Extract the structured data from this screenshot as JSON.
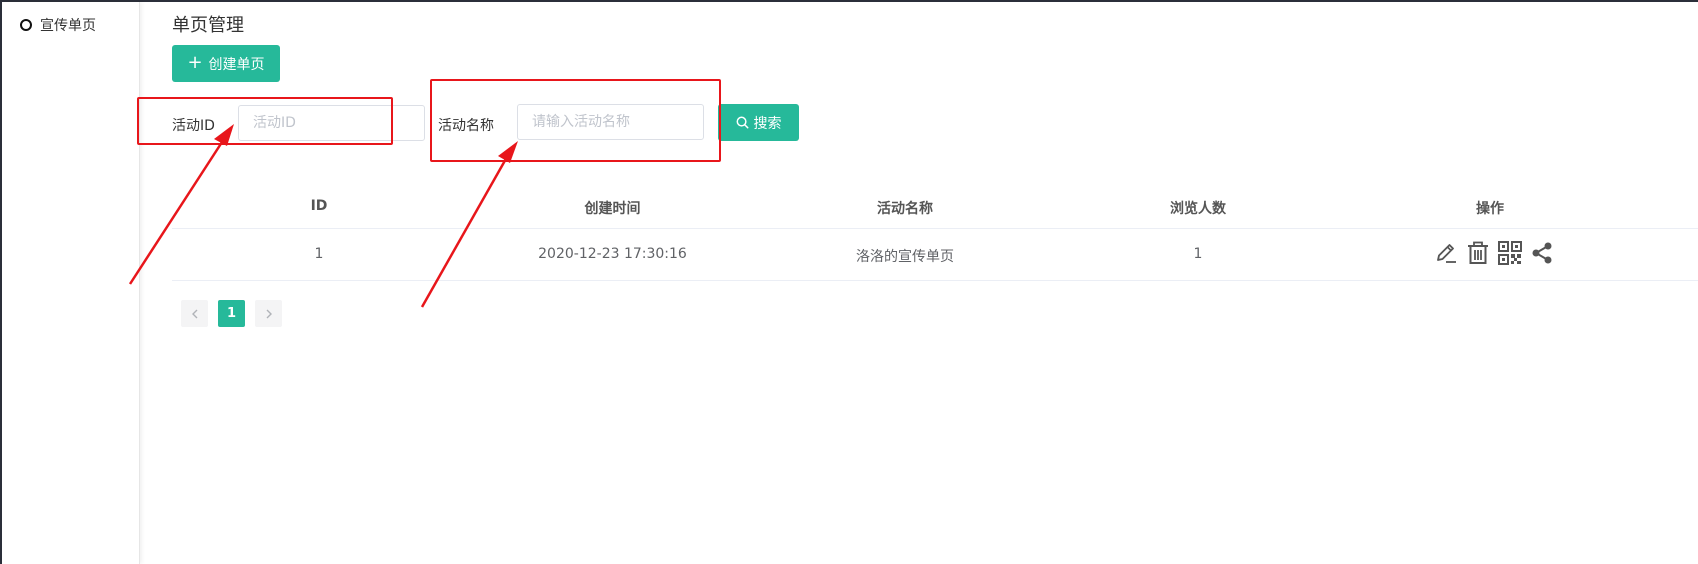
{
  "sidebar": {
    "items": [
      {
        "label": "宣传单页"
      }
    ]
  },
  "main": {
    "title": "单页管理",
    "create_button": "创建单页",
    "filters": {
      "activity_id": {
        "label": "活动ID",
        "placeholder": "活动ID",
        "value": ""
      },
      "activity_name": {
        "label": "活动名称",
        "placeholder": "请输入活动名称",
        "value": ""
      },
      "search_button": "搜索"
    },
    "table": {
      "columns": [
        "ID",
        "创建时间",
        "活动名称",
        "浏览人数",
        "操作"
      ],
      "rows": [
        {
          "id": "1",
          "created": "2020-12-23 17:30:16",
          "name": "洛洛的宣传单页",
          "views": "1"
        }
      ],
      "actions": [
        "edit-icon",
        "delete-icon",
        "qrcode-icon",
        "share-icon"
      ]
    },
    "pagination": {
      "pages": [
        "1"
      ],
      "current": "1"
    }
  },
  "colors": {
    "accent": "#26b99a",
    "annotation": "#e8161b",
    "sidebar_border": "#e6e6e6"
  }
}
